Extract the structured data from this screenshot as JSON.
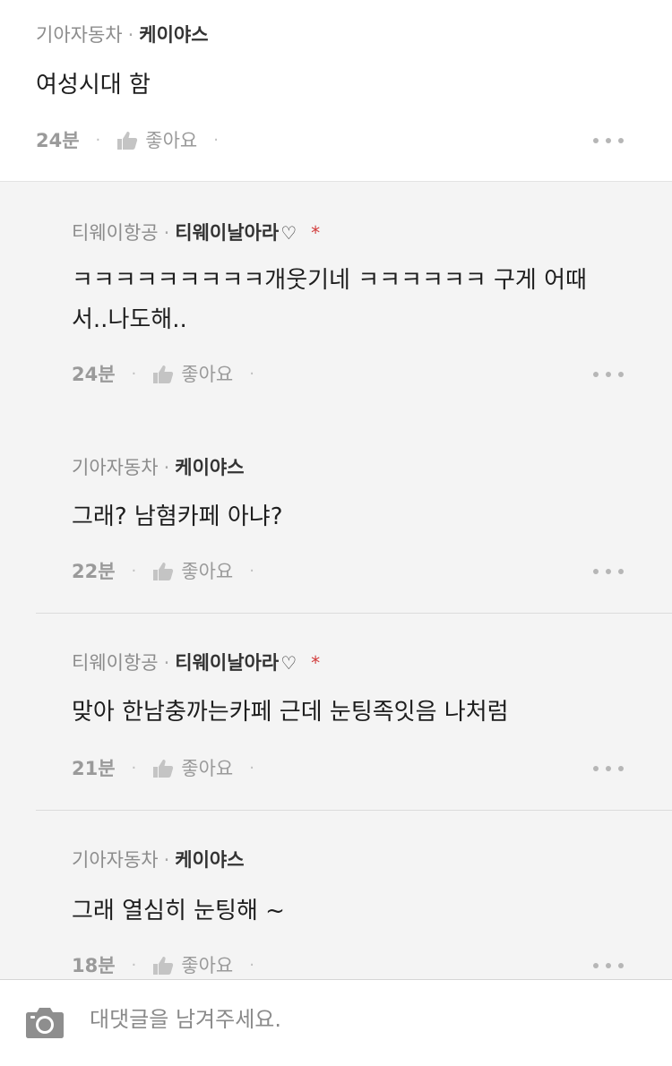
{
  "comments": [
    {
      "cafe": "기아자동차",
      "nick": "케이야스",
      "heart": false,
      "star": false,
      "body": "여성시대 함",
      "time": "24분",
      "like_label": "좋아요"
    },
    {
      "cafe": "티웨이항공",
      "nick": "티웨이날아라",
      "heart": true,
      "star": true,
      "body": "ㅋㅋㅋㅋㅋㅋㅋㅋㅋ개웃기네 ㅋㅋㅋㅋㅋㅋ 구게 어때서..나도해..",
      "time": "24분",
      "like_label": "좋아요"
    },
    {
      "cafe": "기아자동차",
      "nick": "케이야스",
      "heart": false,
      "star": false,
      "body": "그래?  남혐카페 아냐?",
      "time": "22분",
      "like_label": "좋아요"
    },
    {
      "cafe": "티웨이항공",
      "nick": "티웨이날아라",
      "heart": true,
      "star": true,
      "body": "맞아 한남충까는카페 근데 눈팅족잇음 나처럼",
      "time": "21분",
      "like_label": "좋아요"
    },
    {
      "cafe": "기아자동차",
      "nick": "케이야스",
      "heart": false,
      "star": false,
      "body": "그래 열심히 눈팅해 ~",
      "time": "18분",
      "like_label": "좋아요"
    }
  ],
  "symbols": {
    "separator": "·",
    "heart": "♡",
    "star": "*"
  },
  "reply_bar": {
    "placeholder": "대댓글을 남겨주세요.",
    "camera_icon": "camera-icon"
  },
  "colors": {
    "reply_background": "#f4f4f4",
    "star_red": "#d23c3c"
  }
}
